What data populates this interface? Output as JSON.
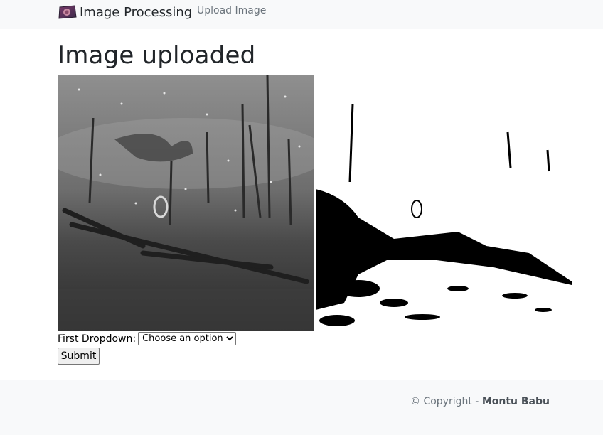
{
  "navbar": {
    "brand_logo_icon": "app-logo-icon",
    "brand_title": "Image Processing",
    "links": [
      {
        "label": "Upload Image"
      }
    ]
  },
  "main": {
    "title": "Image uploaded",
    "images": [
      {
        "name": "original-image",
        "style": "grayscale photo of a burnt forest with fallen logs"
      },
      {
        "name": "processed-image",
        "style": "binary threshold black and white"
      }
    ],
    "form": {
      "dropdown_label": "First Dropdown:",
      "dropdown_selected": "Choose an option",
      "submit_label": "Submit"
    }
  },
  "footer": {
    "copyright_prefix": "© Copyright -",
    "author": "Montu Babu"
  }
}
